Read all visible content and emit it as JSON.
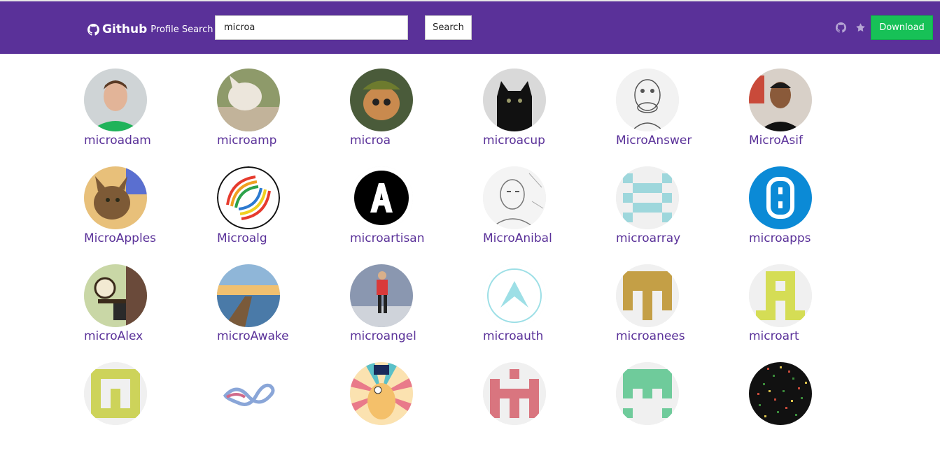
{
  "header": {
    "brand_bold": "Github",
    "brand_light": "Profile Search",
    "search_value": "microa",
    "search_button": "Search",
    "download_button": "Download",
    "icons": [
      "github-icon",
      "star-icon"
    ]
  },
  "colors": {
    "navbar": "#5a3199",
    "username": "#5a3199",
    "download": "#17c157"
  },
  "users": [
    {
      "name": "microadam"
    },
    {
      "name": "microamp"
    },
    {
      "name": "microa"
    },
    {
      "name": "microacup"
    },
    {
      "name": "MicroAnswer"
    },
    {
      "name": "MicroAsif"
    },
    {
      "name": "MicroApples"
    },
    {
      "name": "Microalg"
    },
    {
      "name": "microartisan"
    },
    {
      "name": "MicroAnibal"
    },
    {
      "name": "microarray"
    },
    {
      "name": "microapps"
    },
    {
      "name": "microAlex"
    },
    {
      "name": "microAwake"
    },
    {
      "name": "microangel"
    },
    {
      "name": "microauth"
    },
    {
      "name": "microanees"
    },
    {
      "name": "microart"
    },
    {
      "name": ""
    },
    {
      "name": ""
    },
    {
      "name": ""
    },
    {
      "name": ""
    },
    {
      "name": ""
    },
    {
      "name": ""
    }
  ]
}
